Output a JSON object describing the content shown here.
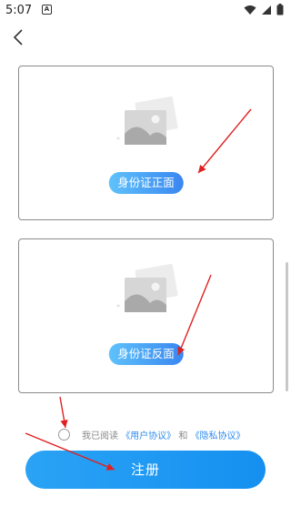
{
  "status_bar": {
    "time": "5:07",
    "notification_letter": "A"
  },
  "header": {
    "back_icon": "chevron-left-icon"
  },
  "id_front": {
    "label": "身份证正面",
    "icon": "image-placeholder-icon"
  },
  "id_back": {
    "label": "身份证反面",
    "icon": "image-placeholder-icon"
  },
  "agreement": {
    "prefix": "我已阅读",
    "user_agreement": "《用户协议》",
    "connector": "和",
    "privacy_agreement": "《隐私协议》"
  },
  "register_button": {
    "label": "注册"
  },
  "colors": {
    "accent": "#1590f0",
    "pill_gradient_start": "#5ec2fb",
    "pill_gradient_end": "#3a86f0",
    "annotation_arrow": "#e02020"
  }
}
